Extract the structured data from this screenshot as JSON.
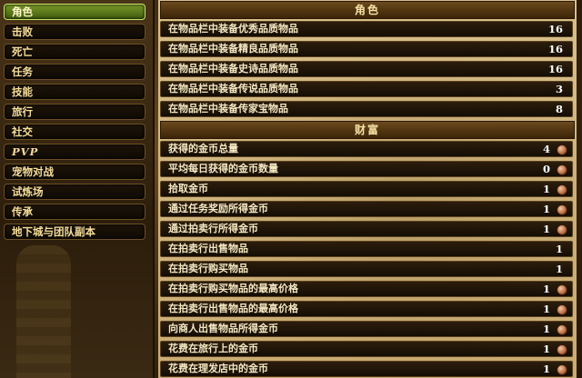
{
  "sidebar": {
    "categories": [
      {
        "label": "角色"
      },
      {
        "label": "击败"
      },
      {
        "label": "死亡"
      },
      {
        "label": "任务"
      },
      {
        "label": "技能"
      },
      {
        "label": "旅行"
      },
      {
        "label": "社交"
      },
      {
        "label": "PVP"
      },
      {
        "label": "宠物对战"
      },
      {
        "label": "试炼场"
      },
      {
        "label": "传承"
      },
      {
        "label": "地下城与团队副本"
      }
    ],
    "selected_index": 0,
    "selected_color": "#5f7d1c"
  },
  "sections": [
    {
      "title": "角色",
      "rows": [
        {
          "label": "在物品栏中装备优秀品质物品",
          "value": "16"
        },
        {
          "label": "在物品栏中装备精良品质物品",
          "value": "16"
        },
        {
          "label": "在物品栏中装备史诗品质物品",
          "value": "16"
        },
        {
          "label": "在物品栏中装备传说品质物品",
          "value": "3"
        },
        {
          "label": "在物品栏中装备传家宝物品",
          "value": "8"
        }
      ]
    },
    {
      "title": "财富",
      "rows": [
        {
          "label": "获得的金币总量",
          "value": "4",
          "coin": "copper-coin-icon"
        },
        {
          "label": "平均每日获得的金币数量",
          "value": "0",
          "coin": "copper-coin-icon"
        },
        {
          "label": "拾取金币",
          "value": "1",
          "coin": "copper-coin-icon"
        },
        {
          "label": "通过任务奖励所得金币",
          "value": "1",
          "coin": "copper-coin-icon"
        },
        {
          "label": "通过拍卖行所得金币",
          "value": "1",
          "coin": "copper-coin-icon"
        },
        {
          "label": "在拍卖行出售物品",
          "value": "1"
        },
        {
          "label": "在拍卖行购买物品",
          "value": "1"
        },
        {
          "label": "在拍卖行购买物品的最高价格",
          "value": "1",
          "coin": "copper-coin-icon"
        },
        {
          "label": "在拍卖行出售物品的最高价格",
          "value": "1",
          "coin": "copper-coin-icon"
        },
        {
          "label": "向商人出售物品所得金币",
          "value": "1",
          "coin": "copper-coin-icon"
        },
        {
          "label": "花费在旅行上的金币",
          "value": "1",
          "coin": "copper-coin-icon"
        },
        {
          "label": "花费在理发店中的金币",
          "value": "1",
          "coin": "copper-coin-icon"
        }
      ]
    }
  ],
  "colors": {
    "header_bg": "#4e3412",
    "row_bg": "#1f1508",
    "label_text": "#f4e7c2",
    "panel_bg": "#d0b47e"
  }
}
